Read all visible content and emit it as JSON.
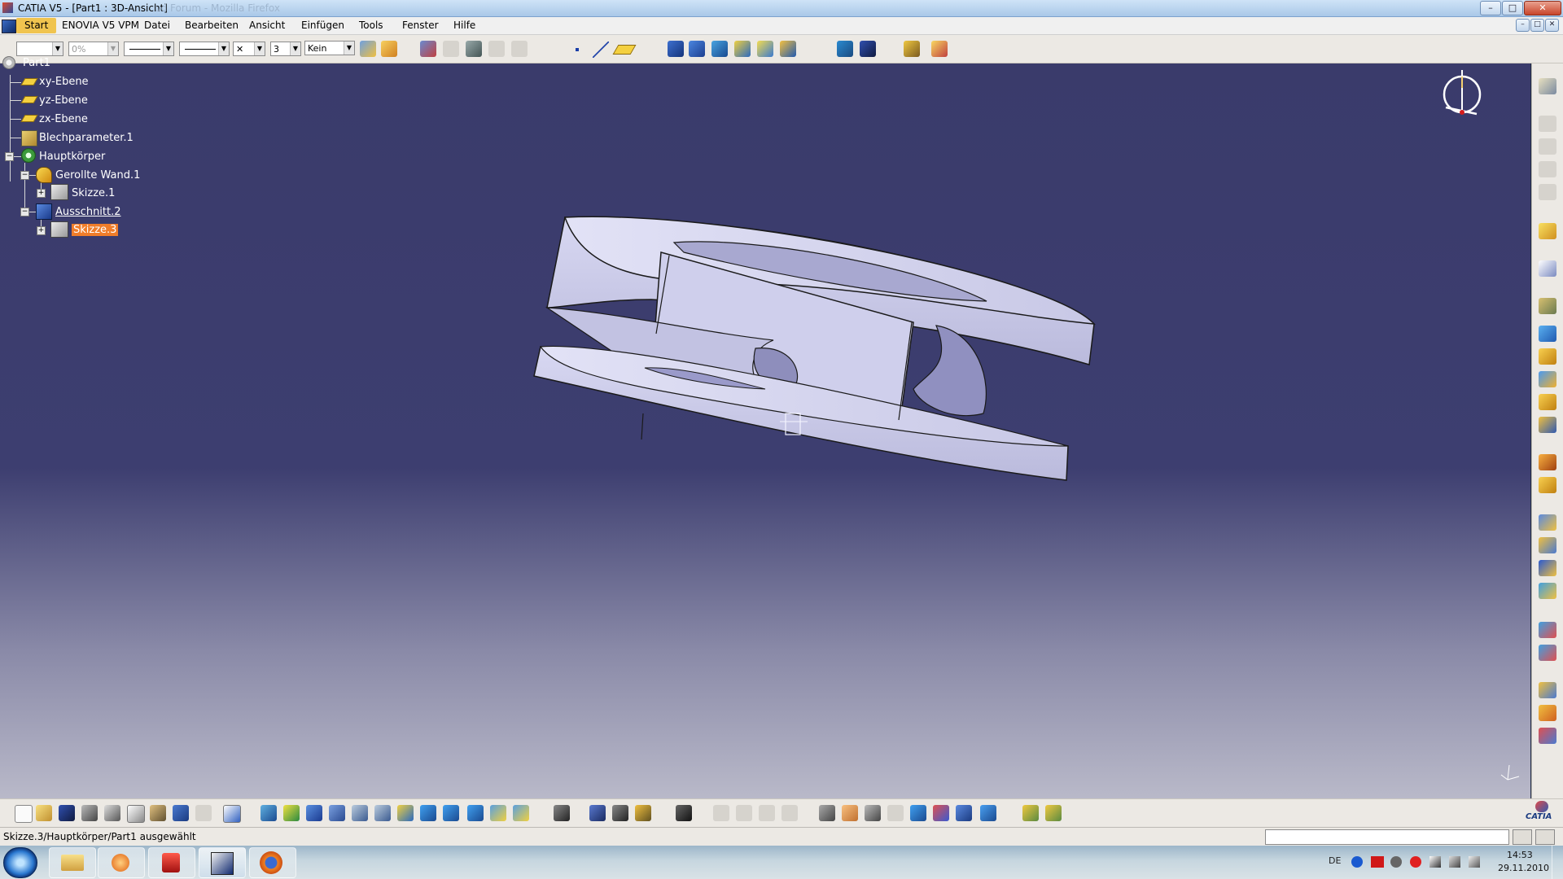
{
  "window": {
    "title": "CATIA V5 - [Part1 : 3D-Ansicht]",
    "ghost_title": "ud Forum - Mozilla Firefox",
    "buttons": [
      "–",
      "□",
      "✕"
    ]
  },
  "menu": {
    "start": "Start",
    "items": [
      "ENOVIA V5 VPM",
      "Datei",
      "Bearbeiten",
      "Ansicht",
      "Einfügen",
      "Tools",
      "Fenster",
      "Hilfe"
    ]
  },
  "toolbar": {
    "percent": "0%",
    "layer": "Kein",
    "point_size": "3",
    "line_x": "✕"
  },
  "tree": {
    "root": "Part1",
    "items": [
      {
        "label": "xy-Ebene"
      },
      {
        "label": "yz-Ebene"
      },
      {
        "label": "zx-Ebene"
      },
      {
        "label": "Blechparameter.1"
      },
      {
        "label": "Hauptkörper"
      },
      {
        "label": "Gerollte Wand.1"
      },
      {
        "label": "Skizze.1"
      },
      {
        "label": "Ausschnitt.2"
      },
      {
        "label": "Skizze.3"
      }
    ]
  },
  "status": {
    "text": "Skizze.3/Hauptkörper/Part1 ausgewählt"
  },
  "taskbar": {
    "lang": "DE",
    "time": "14:53",
    "date": "29.11.2010"
  },
  "brand": {
    "logo": "CATIA"
  },
  "colors": {
    "selection": "#f07d2a",
    "viewport_top": "#3a3b6b",
    "part": "#d4d4f0"
  }
}
